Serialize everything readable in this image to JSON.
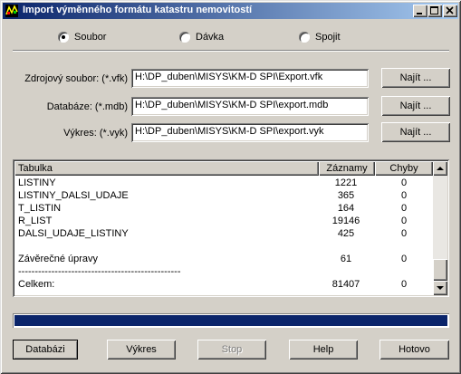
{
  "window": {
    "title": "Import výměnného formátu katastru nemovitostí",
    "minimize_label": "_",
    "maximize_label": "□",
    "close_label": "×"
  },
  "mode": {
    "options": [
      "Soubor",
      "Dávka",
      "Spojit"
    ],
    "selected": "Soubor"
  },
  "form": {
    "source_label": "Zdrojový soubor: (*.vfk)",
    "source_value": "H:\\DP_duben\\MISYS\\KM-D SPI\\Export.vfk",
    "db_label": "Databáze: (*.mdb)",
    "db_value": "H:\\DP_duben\\MISYS\\KM-D SPI\\export.mdb",
    "drawing_label": "Výkres: (*.vyk)",
    "drawing_value": "H:\\DP_duben\\MISYS\\KM-D SPI\\export.vyk",
    "find_label": "Najít ..."
  },
  "table": {
    "columns": [
      "Tabulka",
      "Záznamy",
      "Chyby"
    ],
    "rows": [
      {
        "name": "LISTINY",
        "records": "1221",
        "errors": "0"
      },
      {
        "name": "LISTINY_DALSI_UDAJE",
        "records": "365",
        "errors": "0"
      },
      {
        "name": "T_LISTIN",
        "records": "164",
        "errors": "0"
      },
      {
        "name": "R_LIST",
        "records": "19146",
        "errors": "0"
      },
      {
        "name": "DALSI_UDAJE_LISTINY",
        "records": "425",
        "errors": "0"
      },
      {
        "name": "",
        "records": "",
        "errors": ""
      },
      {
        "name": "Závěrečné úpravy",
        "records": "61",
        "errors": "0"
      },
      {
        "name": "-------------------------------------------------",
        "records": "",
        "errors": ""
      },
      {
        "name": "Celkem:",
        "records": "81407",
        "errors": "0"
      }
    ]
  },
  "progress": {
    "value": 1.0
  },
  "buttons": {
    "database": "Databázi",
    "drawing": "Výkres",
    "stop": "Stop",
    "help": "Help",
    "done": "Hotovo"
  }
}
